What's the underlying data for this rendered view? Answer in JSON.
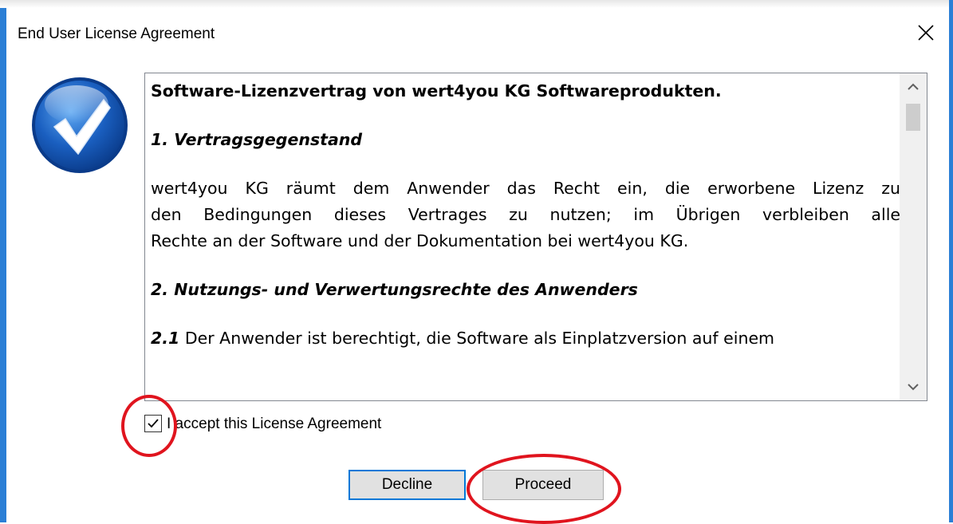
{
  "window": {
    "title": "End User License Agreement"
  },
  "icons": {
    "close": "close-icon",
    "logo": "checkmark-badge-icon",
    "scroll_up": "chevron-up-icon",
    "scroll_down": "chevron-down-icon",
    "check": "checkmark-icon"
  },
  "license": {
    "heading": "Software-Lizenzvertrag von wert4you KG Softwareprodukten.",
    "section1_title": "1. Vertragsgegenstand",
    "section1_lines": [
      "wert4you KG räumt dem Anwender das Recht ein, die erworbene Lizenz zu",
      "den Bedingungen dieses Vertrages zu nutzen; im Übrigen verbleiben alle",
      "Rechte an der Software und der Dokumentation bei wert4you KG."
    ],
    "section2_title": "2. Nutzungs- und Verwertungsrechte des Anwenders",
    "section21_number": "2.1",
    "section21_text": " Der Anwender ist berechtigt, die Software als Einplatzversion auf einem"
  },
  "accept": {
    "checked": true,
    "label": "I accept this License Agreement"
  },
  "buttons": {
    "decline": "Decline",
    "proceed": "Proceed"
  },
  "colors": {
    "window_border": "#2b7fd6",
    "focus_border": "#0078d7",
    "annotation_ring": "#e0141e",
    "logo_blue": "#1a5fc0"
  }
}
